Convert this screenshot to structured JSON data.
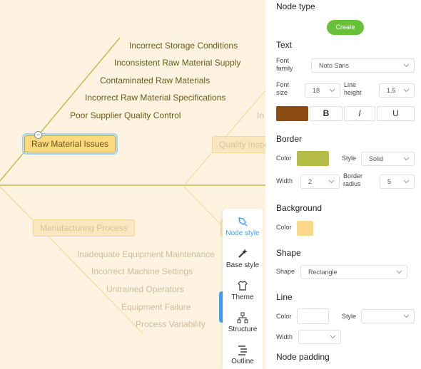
{
  "canvas": {
    "colors": {
      "bone_active": "#c8b84d",
      "bone_dim": "#efe0a8",
      "background": "#fdf3e0"
    },
    "causes_top": [
      "Incorrect Storage Conditions",
      "Inconsistent Raw Material Supply",
      "Contaminated Raw Materials",
      "Incorrect Raw Material Specifications",
      "Poor Supplier Quality Control"
    ],
    "causes_bottom": [
      "Inadequate Equipment Maintenance",
      "Incorrect Machine Settings",
      "Untrained Operators",
      "Equipment Failure",
      "Process Variability"
    ],
    "partial_text": "In",
    "nodes": {
      "raw_material": "Raw Material Issues",
      "quality": "Quality Inspe",
      "manufacturing": "Manufacturing Process"
    },
    "collapse_symbol": "−"
  },
  "toolbar": {
    "items": [
      {
        "label": "Node style",
        "icon": "brush-icon",
        "active": true
      },
      {
        "label": "Base style",
        "icon": "magic-wand-icon",
        "active": false
      },
      {
        "label": "Theme",
        "icon": "shirt-icon",
        "active": false
      },
      {
        "label": "Structure",
        "icon": "structure-icon",
        "active": false
      },
      {
        "label": "Outline",
        "icon": "outline-icon",
        "active": false
      }
    ],
    "accent_color": "#409eff"
  },
  "panel": {
    "node_type": {
      "title": "Node type",
      "create_label": "Create",
      "create_color": "#67c23a"
    },
    "text": {
      "title": "Text",
      "font_family_label": "Font family",
      "font_family_value": "Noto Sans",
      "font_size_label": "Font size",
      "font_size_value": "18",
      "line_height_label": "Line height",
      "line_height_value": "1.5",
      "text_color": "#8b4c12",
      "bold_label": "B",
      "italic_label": "I",
      "underline_label": "U"
    },
    "border": {
      "title": "Border",
      "color_label": "Color",
      "color_value": "#b6bd47",
      "style_label": "Style",
      "style_value": "Solid",
      "width_label": "Width",
      "width_value": "2",
      "radius_label": "Border radius",
      "radius_value": "5"
    },
    "background": {
      "title": "Background",
      "color_label": "Color",
      "color_value": "#fcd98a"
    },
    "shape": {
      "title": "Shape",
      "shape_label": "Shape",
      "shape_value": "Rectangle"
    },
    "line": {
      "title": "Line",
      "color_label": "Color",
      "color_value": "#ffffff",
      "style_label": "Style",
      "style_value": "",
      "width_label": "Width",
      "width_value": ""
    },
    "node_padding": {
      "title": "Node padding"
    }
  }
}
